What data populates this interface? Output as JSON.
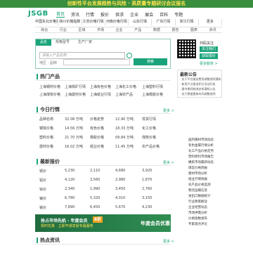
{
  "banner": {
    "text": "创新性平台发展趋势与风险 · 高质量专题研讨会议报名"
  },
  "header": {
    "logo": "JSGB",
    "nav": [
      "首页",
      "资讯",
      "行情",
      "报价",
      "供求",
      "企业",
      "展会",
      "百科",
      "专题"
    ]
  },
  "menu_row1": [
    "中国东北价格指数",
    "四川价格指数",
    "江苏价格行情",
    "河南价格行情",
    "山东行情",
    "广东行情",
    "浙江行情",
    "更多"
  ],
  "menu_row2": [
    "综合",
    "行业",
    "区域",
    "市场",
    "企业",
    "产品",
    "数据",
    "报告",
    "图表",
    "资讯"
  ],
  "search": {
    "tabs": [
      "品名",
      "规格型号",
      "生产厂家"
    ],
    "placeholder": "请输入产品名称",
    "label": "地区 · 品种",
    "button": "搜索"
  },
  "side": {
    "title": "扫码关注",
    "btn1": "关注我们",
    "btn2": "获取报价",
    "link": "更多服务 >"
  },
  "notice": {
    "title": "最新公告",
    "lines": [
      "· 关于平台服务费用调整说明通知",
      "· 新用户注册送积分活动开启",
      "· 春节期间物流安排通知公告",
      "· 关于数据更新时间调整说明"
    ]
  },
  "section1": {
    "title": "热门产品",
    "rows": [
      [
        "上海钢材价格",
        "上海铁矿行情",
        "上海有色价格",
        "上海化工价格",
        "上海塑料行情"
      ],
      [
        "上海煤炭价格",
        "上海建材价格",
        "上海纸业行情",
        "上海农产品",
        "上海橡胶价格"
      ]
    ]
  },
  "section2": {
    "title": "今日行情",
    "more": "更多 >",
    "rows": [
      [
        "品种名称",
        "32.08 万吨",
        "价格走势",
        "12.90 万吨",
        "现货行情"
      ],
      [
        "钢铁价格",
        "14.56 万吨",
        "有色价格",
        "18.33 万吨",
        "化工价格"
      ],
      [
        "塑料价格",
        "21.70 万吨",
        "橡胶价格",
        "09.84 万吨",
        "煤炭价格"
      ],
      [
        "建材价格",
        "16.02 万吨",
        "纸业价格",
        "11.45 万吨",
        "农产品价格"
      ]
    ]
  },
  "section3": {
    "title": "最新报价",
    "more": "更多 >",
    "rows": [
      [
        "铜价",
        "5,230",
        "2,110",
        "4,680",
        "3,920"
      ],
      [
        "铝价",
        "4,120",
        "3,560",
        "2,980",
        "1,870"
      ],
      [
        "锌价",
        "2,340",
        "1,990",
        "3,450",
        "2,760"
      ],
      [
        "镍价",
        "6,780",
        "5,320",
        "4,010",
        "3,150"
      ],
      [
        "锡价",
        "7,890",
        "6,450",
        "5,670",
        "4,230"
      ]
    ]
  },
  "ad": {
    "line1": "抢占市场先机 · 年度会员",
    "badge": "8折",
    "line2": "限时优惠 · 立即开通享受专属服务",
    "right": "年度会员优惠"
  },
  "section4": {
    "title": "热点资讯",
    "more": "更多 >"
  },
  "side_list": [
    "国内钢材市场动态",
    "有色金属行情分析",
    "化工产品价格走势",
    "塑料原料市场报告",
    "橡胶市场最新动态",
    "煤炭价格周报",
    "建材市场分析",
    "纸业行情快报",
    "农产品价格监测",
    "物流运输信息",
    "进出口数据统计",
    "行业政策解读",
    "企业经营动态",
    "市场供需分析",
    "价格指数发布",
    "专家观点评论"
  ]
}
